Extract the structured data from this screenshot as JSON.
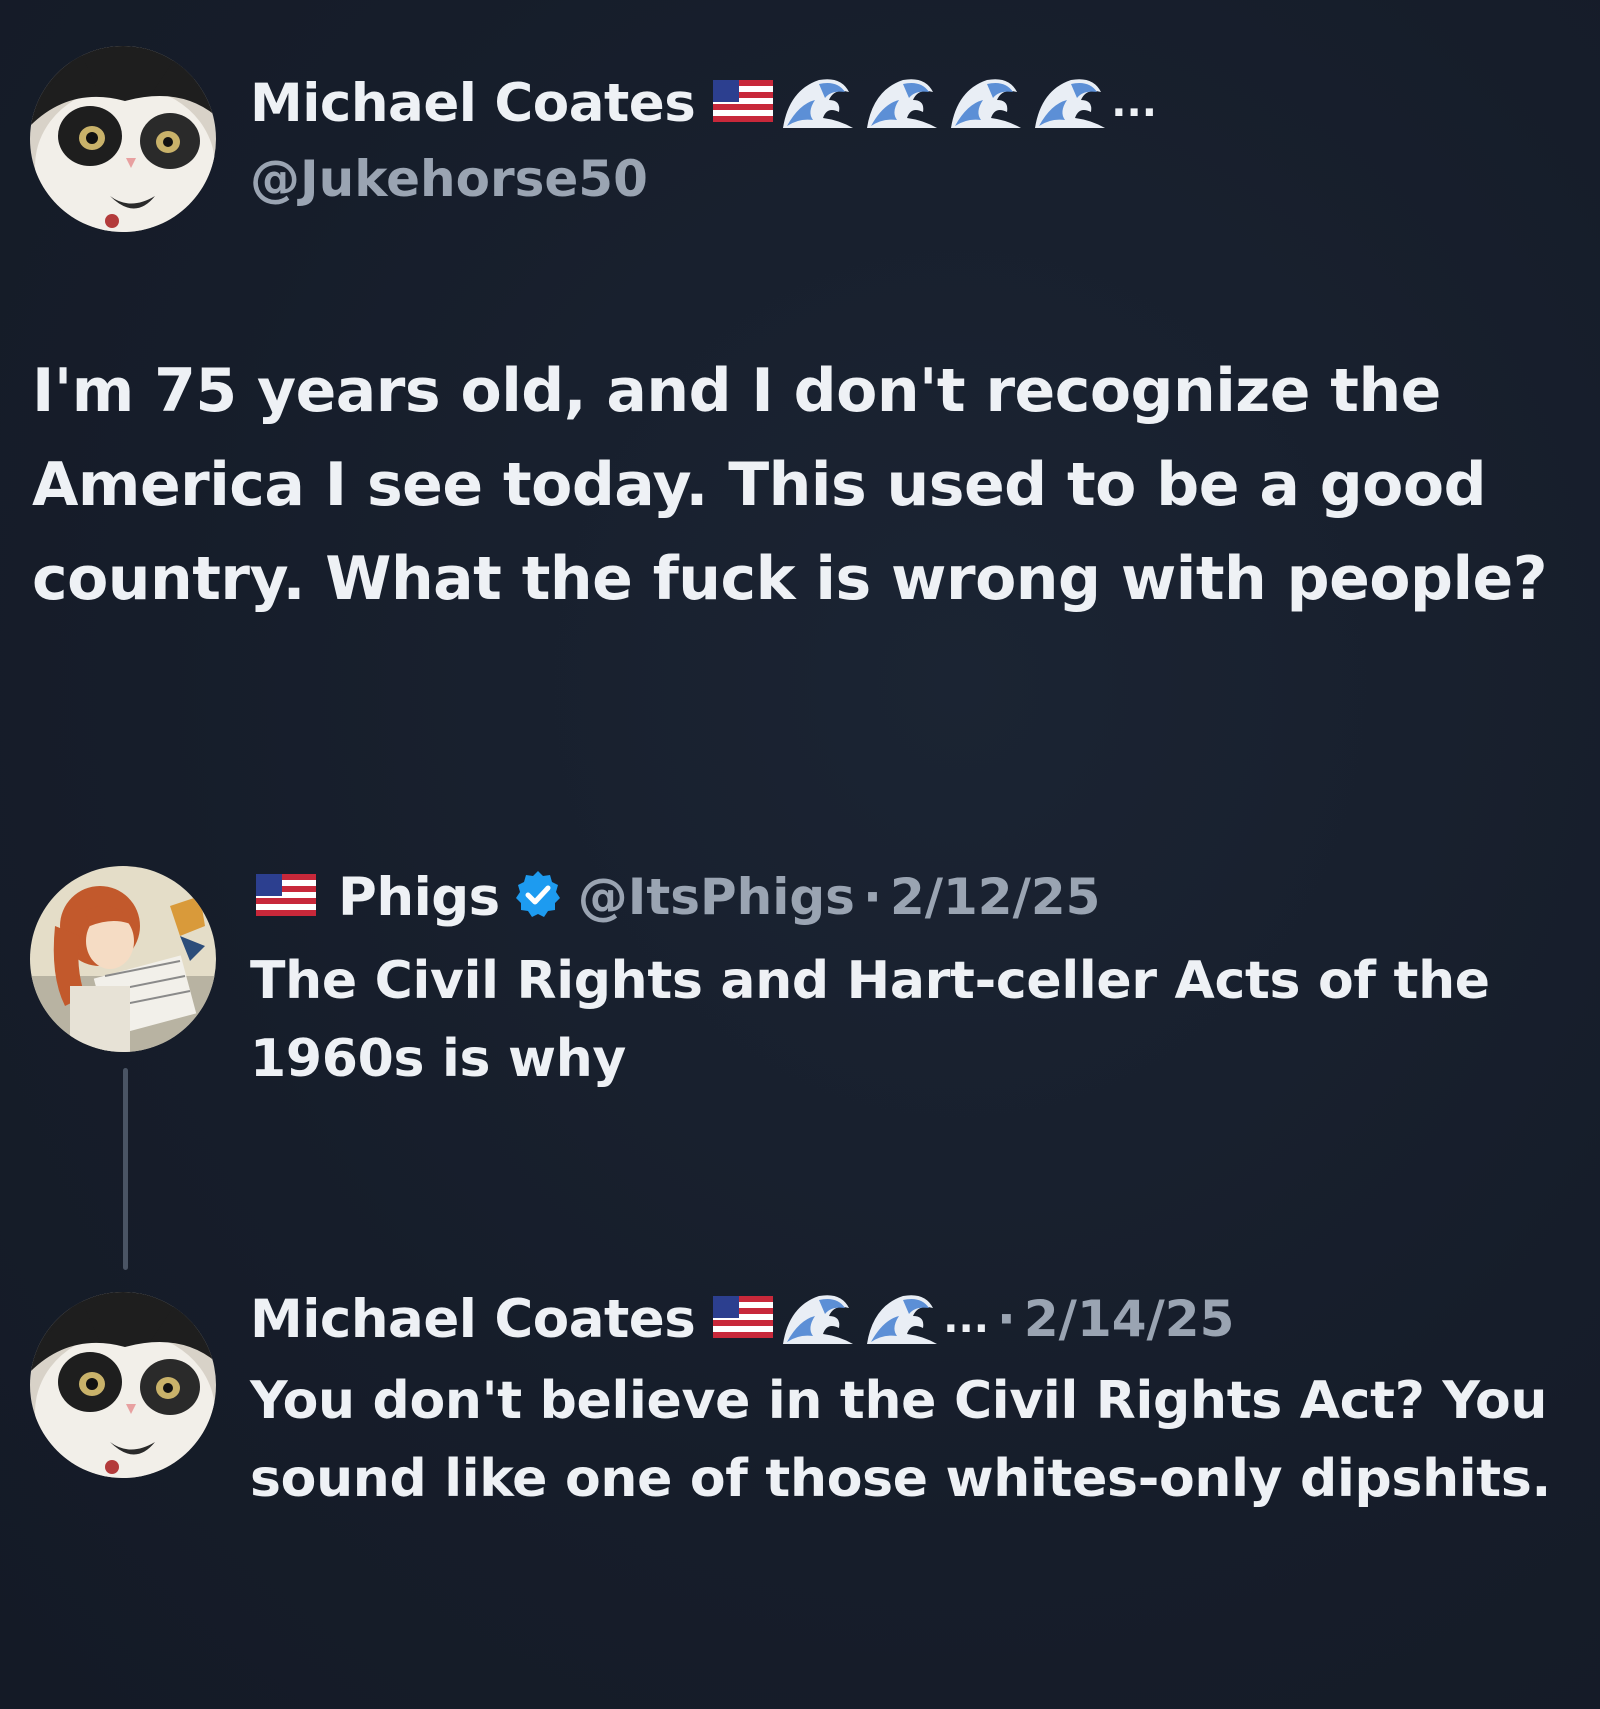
{
  "tweet": {
    "author": {
      "display_name": "Michael Coates",
      "handle": "@Jukehorse50",
      "ellipsis": "..."
    },
    "text": "I'm 75 years old, and I don't recognize the America I see today. This used to be a good country. What the fuck is wrong with people?"
  },
  "replies": [
    {
      "display_name": "Phigs",
      "handle": "@ItsPhigs",
      "separator": "·",
      "date": "2/12/25",
      "text": "The Civil Rights and Hart-celler Acts of the 1960s is why"
    },
    {
      "display_name": "Michael Coates",
      "ellipsis": "...",
      "separator": "·",
      "date": "2/14/25",
      "text": "You don't believe in the Civil Rights Act? You sound like one of those whites-only dipshits."
    }
  ],
  "icons": {
    "flag": "us-flag-icon",
    "wave": "water-wave-icon",
    "verified": "verified-badge-icon",
    "avatar_cat": "cat-avatar",
    "avatar_anime": "anime-avatar"
  },
  "colors": {
    "background": "#161d2a",
    "text": "#eef1f5",
    "muted": "#9aa4b2",
    "verified": "#1d9bf0",
    "thread_line": "#4a5464"
  }
}
